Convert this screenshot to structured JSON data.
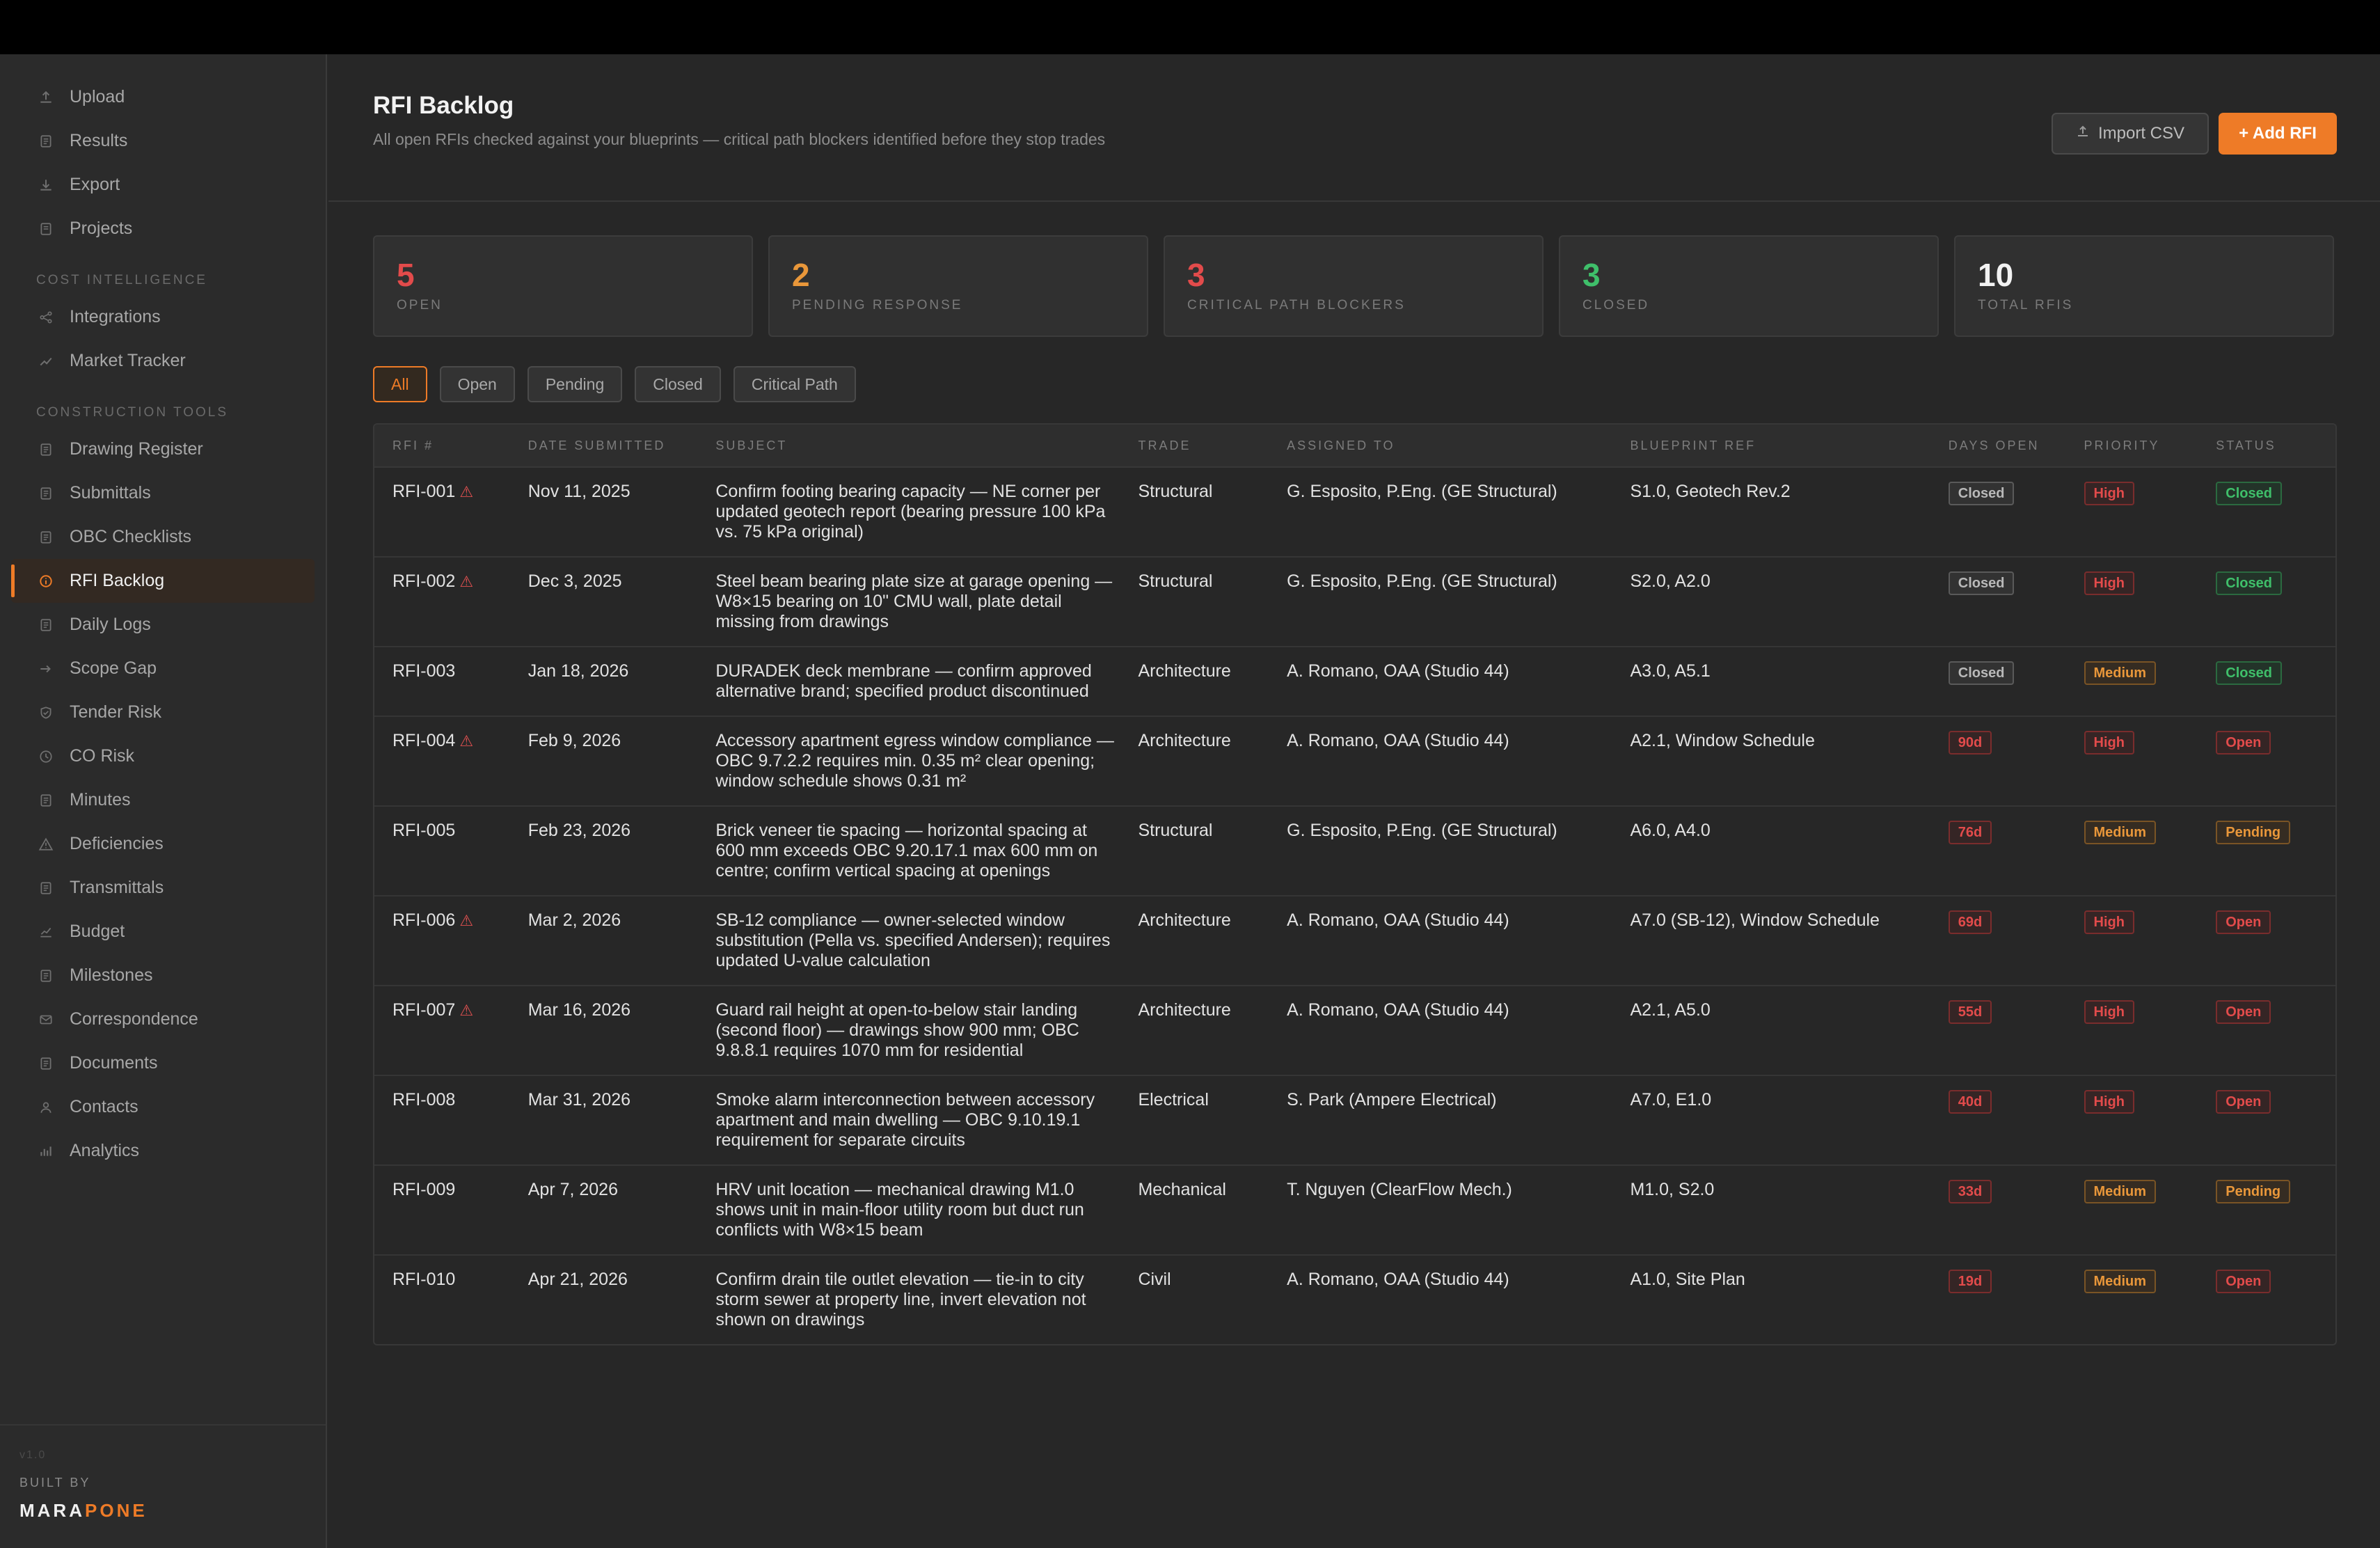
{
  "sidebar": {
    "items_top": [
      {
        "label": "Upload",
        "icon": "upload-icon"
      },
      {
        "label": "Results",
        "icon": "document-icon"
      },
      {
        "label": "Export",
        "icon": "download-icon"
      },
      {
        "label": "Projects",
        "icon": "folder-icon"
      }
    ],
    "section_cost": "COST INTELLIGENCE",
    "items_cost": [
      {
        "label": "Integrations",
        "icon": "share-icon"
      },
      {
        "label": "Market Tracker",
        "icon": "trend-icon"
      }
    ],
    "section_tools": "CONSTRUCTION TOOLS",
    "items_tools": [
      {
        "label": "Drawing Register",
        "icon": "document-icon"
      },
      {
        "label": "Submittals",
        "icon": "document-icon"
      },
      {
        "label": "OBC Checklists",
        "icon": "document-icon"
      },
      {
        "label": "RFI Backlog",
        "icon": "info-icon",
        "active": true
      },
      {
        "label": "Daily Logs",
        "icon": "document-icon"
      },
      {
        "label": "Scope Gap",
        "icon": "arrow-icon"
      },
      {
        "label": "Tender Risk",
        "icon": "shield-icon"
      },
      {
        "label": "CO Risk",
        "icon": "clock-icon"
      },
      {
        "label": "Minutes",
        "icon": "document-icon"
      },
      {
        "label": "Deficiencies",
        "icon": "warning-icon"
      },
      {
        "label": "Transmittals",
        "icon": "document-icon"
      },
      {
        "label": "Budget",
        "icon": "chart-icon"
      },
      {
        "label": "Milestones",
        "icon": "document-icon"
      },
      {
        "label": "Correspondence",
        "icon": "mail-icon"
      },
      {
        "label": "Documents",
        "icon": "document-icon"
      },
      {
        "label": "Contacts",
        "icon": "user-icon"
      },
      {
        "label": "Analytics",
        "icon": "bar-chart-icon"
      }
    ],
    "version": "v1.0",
    "built_by": "BUILT BY",
    "brand_a": "MARA",
    "brand_b": "PONE"
  },
  "header": {
    "title": "RFI Backlog",
    "subtitle": "All open RFIs checked against your blueprints — critical path blockers identified before they stop trades",
    "import_label": "Import CSV",
    "add_label": "+ Add RFI"
  },
  "stats": [
    {
      "value": "5",
      "label": "OPEN",
      "color": "#e24b4b"
    },
    {
      "value": "2",
      "label": "PENDING RESPONSE",
      "color": "#e9973a"
    },
    {
      "value": "3",
      "label": "CRITICAL PATH BLOCKERS",
      "color": "#e24b4b"
    },
    {
      "value": "3",
      "label": "CLOSED",
      "color": "#3fbf6a"
    },
    {
      "value": "10",
      "label": "TOTAL RFIS",
      "color": "#f2f2f2"
    }
  ],
  "filters": [
    "All",
    "Open",
    "Pending",
    "Closed",
    "Critical Path"
  ],
  "table": {
    "headers": [
      "RFI #",
      "DATE SUBMITTED",
      "SUBJECT",
      "TRADE",
      "ASSIGNED TO",
      "BLUEPRINT REF",
      "DAYS OPEN",
      "PRIORITY",
      "STATUS"
    ],
    "rows": [
      {
        "id": "RFI-001",
        "critical": true,
        "date": "Nov 11, 2025",
        "subject": "Confirm footing bearing capacity — NE corner per updated geotech report (bearing pressure 100 kPa vs. 75 kPa original)",
        "trade": "Structural",
        "assigned": "G. Esposito, P.Eng. (GE Structural)",
        "ref": "S1.0, Geotech Rev.2",
        "days": "Closed",
        "priority": "High",
        "status": "Closed"
      },
      {
        "id": "RFI-002",
        "critical": true,
        "date": "Dec 3, 2025",
        "subject": "Steel beam bearing plate size at garage opening — W8×15 bearing on 10\" CMU wall, plate detail missing from drawings",
        "trade": "Structural",
        "assigned": "G. Esposito, P.Eng. (GE Structural)",
        "ref": "S2.0, A2.0",
        "days": "Closed",
        "priority": "High",
        "status": "Closed"
      },
      {
        "id": "RFI-003",
        "critical": false,
        "date": "Jan 18, 2026",
        "subject": "DURADEK deck membrane — confirm approved alternative brand; specified product discontinued",
        "trade": "Architecture",
        "assigned": "A. Romano, OAA (Studio 44)",
        "ref": "A3.0, A5.1",
        "days": "Closed",
        "priority": "Medium",
        "status": "Closed"
      },
      {
        "id": "RFI-004",
        "critical": true,
        "date": "Feb 9, 2026",
        "subject": "Accessory apartment egress window compliance — OBC 9.7.2.2 requires min. 0.35 m² clear opening; window schedule shows 0.31 m²",
        "trade": "Architecture",
        "assigned": "A. Romano, OAA (Studio 44)",
        "ref": "A2.1, Window Schedule",
        "days": "90d",
        "priority": "High",
        "status": "Open"
      },
      {
        "id": "RFI-005",
        "critical": false,
        "date": "Feb 23, 2026",
        "subject": "Brick veneer tie spacing — horizontal spacing at 600 mm exceeds OBC 9.20.17.1 max 600 mm on centre; confirm vertical spacing at openings",
        "trade": "Structural",
        "assigned": "G. Esposito, P.Eng. (GE Structural)",
        "ref": "A6.0, A4.0",
        "days": "76d",
        "priority": "Medium",
        "status": "Pending"
      },
      {
        "id": "RFI-006",
        "critical": true,
        "date": "Mar 2, 2026",
        "subject": "SB-12 compliance — owner-selected window substitution (Pella vs. specified Andersen); requires updated U-value calculation",
        "trade": "Architecture",
        "assigned": "A. Romano, OAA (Studio 44)",
        "ref": "A7.0 (SB-12), Window Schedule",
        "days": "69d",
        "priority": "High",
        "status": "Open"
      },
      {
        "id": "RFI-007",
        "critical": true,
        "date": "Mar 16, 2026",
        "subject": "Guard rail height at open-to-below stair landing (second floor) — drawings show 900 mm; OBC 9.8.8.1 requires 1070 mm for residential",
        "trade": "Architecture",
        "assigned": "A. Romano, OAA (Studio 44)",
        "ref": "A2.1, A5.0",
        "days": "55d",
        "priority": "High",
        "status": "Open"
      },
      {
        "id": "RFI-008",
        "critical": false,
        "date": "Mar 31, 2026",
        "subject": "Smoke alarm interconnection between accessory apartment and main dwelling — OBC 9.10.19.1 requirement for separate circuits",
        "trade": "Electrical",
        "assigned": "S. Park (Ampere Electrical)",
        "ref": "A7.0, E1.0",
        "days": "40d",
        "priority": "High",
        "status": "Open"
      },
      {
        "id": "RFI-009",
        "critical": false,
        "date": "Apr 7, 2026",
        "subject": "HRV unit location — mechanical drawing M1.0 shows unit in main-floor utility room but duct run conflicts with W8×15 beam",
        "trade": "Mechanical",
        "assigned": "T. Nguyen (ClearFlow Mech.)",
        "ref": "M1.0, S2.0",
        "days": "33d",
        "priority": "Medium",
        "status": "Pending"
      },
      {
        "id": "RFI-010",
        "critical": false,
        "date": "Apr 21, 2026",
        "subject": "Confirm drain tile outlet elevation — tie-in to city storm sewer at property line, invert elevation not shown on drawings",
        "trade": "Civil",
        "assigned": "A. Romano, OAA (Studio 44)",
        "ref": "A1.0, Site Plan",
        "days": "19d",
        "priority": "Medium",
        "status": "Open"
      }
    ]
  }
}
